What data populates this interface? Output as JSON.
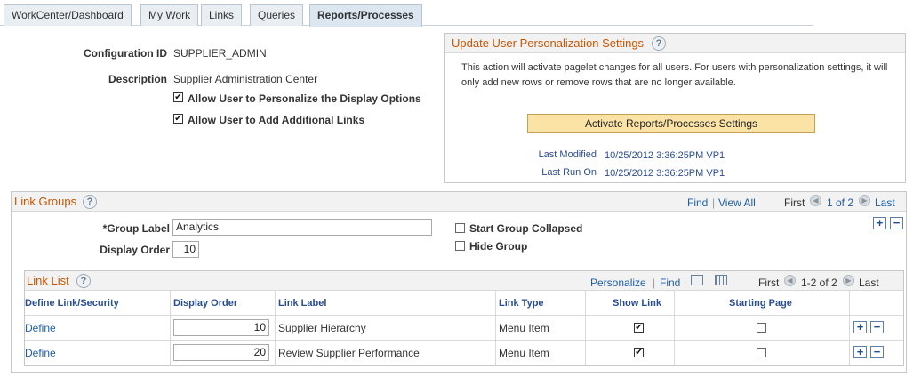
{
  "tabs": [
    {
      "label": "WorkCenter/Dashboard",
      "active": false
    },
    {
      "label": "My Work",
      "active": false
    },
    {
      "label": "Links",
      "active": false
    },
    {
      "label": "Queries",
      "active": false
    },
    {
      "label": "Reports/Processes",
      "active": true
    }
  ],
  "config": {
    "config_id_label": "Configuration ID",
    "config_id_value": "SUPPLIER_ADMIN",
    "description_label": "Description",
    "description_value": "Supplier Administration Center",
    "allow_personalize_label": "Allow User to Personalize the Display Options",
    "allow_personalize_checked": true,
    "allow_links_label": "Allow User to Add Additional Links",
    "allow_links_checked": true
  },
  "update_box": {
    "title": "Update User Personalization Settings",
    "note_line1": "This action will activate pagelet changes for all users.  For users with personalization settings, it will",
    "note_line2": "only add new rows or remove rows that are no longer available.",
    "button_label": "Activate Reports/Processes Settings",
    "last_modified_label": "Last Modified",
    "last_modified_value": "10/25/2012  3:36:25PM  VP1",
    "last_run_label": "Last Run On",
    "last_run_value": "10/25/2012  3:36:25PM  VP1"
  },
  "link_groups": {
    "title": "Link Groups",
    "find": "Find",
    "view_all": "View All",
    "first": "First",
    "range": "1 of 2",
    "last": "Last",
    "group_label_label": "*Group Label",
    "group_label_value": "Analytics",
    "display_order_label": "Display Order",
    "display_order_value": "10",
    "start_collapsed_label": "Start Group Collapsed",
    "start_collapsed_checked": false,
    "hide_group_label": "Hide Group",
    "hide_group_checked": false
  },
  "link_list": {
    "title": "Link List",
    "personalize": "Personalize",
    "find": "Find",
    "first": "First",
    "range": "1-2 of 2",
    "last": "Last",
    "headers": [
      "Define Link/Security",
      "Display Order",
      "Link Label",
      "Link Type",
      "Show Link",
      "Starting Page"
    ],
    "rows": [
      {
        "define": "Define",
        "order": "10",
        "label": "Supplier Hierarchy",
        "type": "Menu Item",
        "show": true,
        "starting": false
      },
      {
        "define": "Define",
        "order": "20",
        "label": "Review Supplier Performance",
        "type": "Menu Item",
        "show": true,
        "starting": false
      }
    ]
  },
  "colors": {
    "section_title": "#cc5500",
    "link": "#1f5fa6",
    "button_bg": "#fbe3a6"
  }
}
